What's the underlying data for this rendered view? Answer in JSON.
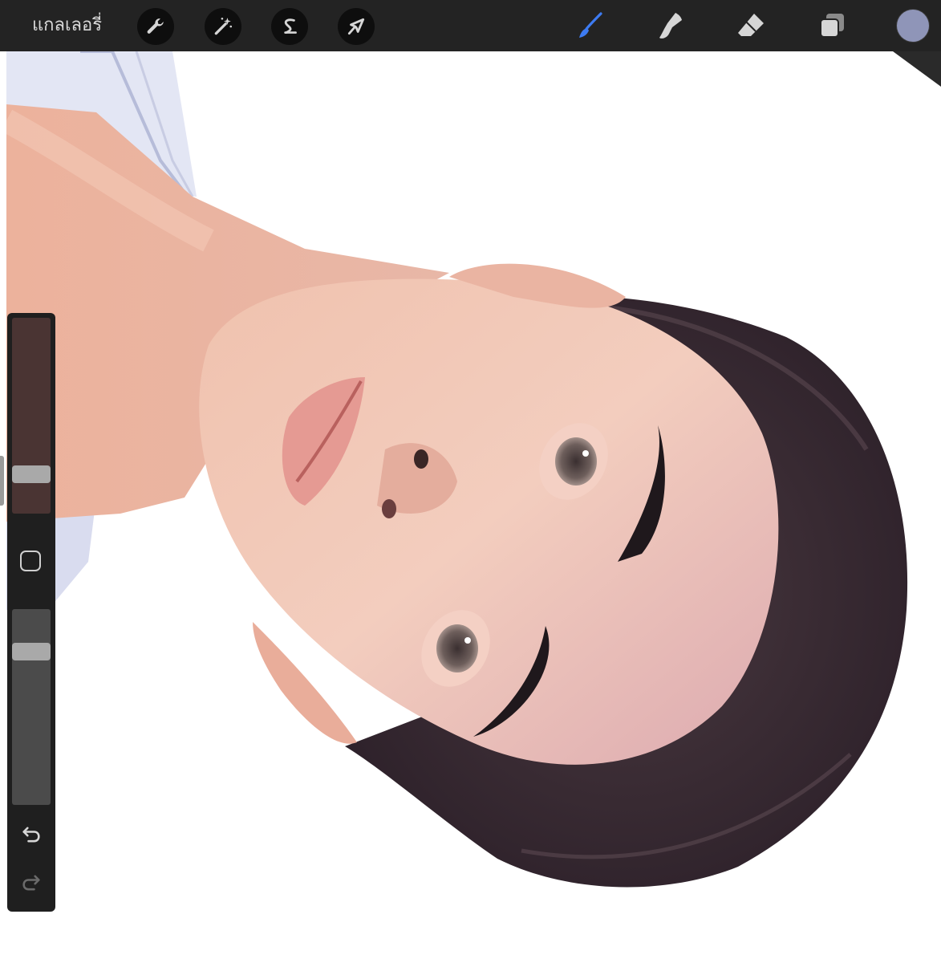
{
  "toolbar": {
    "gallery_label": "แกลเลอรี่",
    "left_tools": [
      {
        "name": "wrench-icon",
        "tool": "actions"
      },
      {
        "name": "magic-wand-icon",
        "tool": "adjustments"
      },
      {
        "name": "selection-s-icon",
        "tool": "selection"
      },
      {
        "name": "arrow-cursor-icon",
        "tool": "transform"
      }
    ],
    "right_tools": [
      {
        "name": "brush-icon",
        "tool": "paint",
        "active": true
      },
      {
        "name": "smudge-icon",
        "tool": "smudge",
        "active": false
      },
      {
        "name": "eraser-icon",
        "tool": "erase",
        "active": false
      },
      {
        "name": "layers-icon",
        "tool": "layers",
        "active": false
      }
    ],
    "current_color": "#8f95b8"
  },
  "sidebar": {
    "brush_size_level": 0.78,
    "opacity_level": 0.8,
    "size_track_color": "#4a3433",
    "opacity_track_color": "#4b4b4b"
  },
  "colors": {
    "toolbar_bg": "#232323",
    "active_tool": "#3d7bf2",
    "icon": "#d6d6d6",
    "canvas_bg": "#ffffff"
  }
}
